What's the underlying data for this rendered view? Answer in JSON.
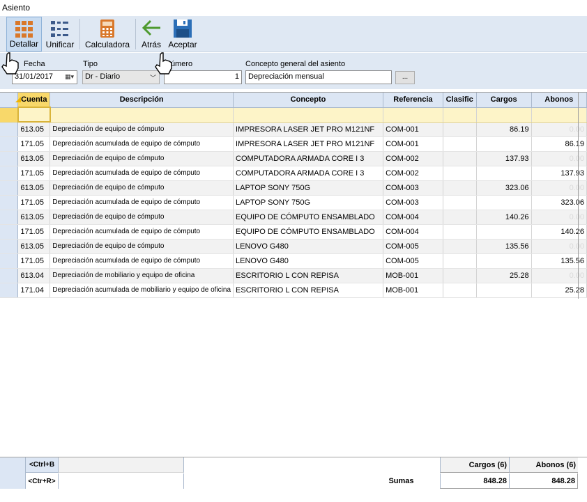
{
  "window": {
    "title": "Asiento"
  },
  "toolbar": {
    "buttons": [
      {
        "label": "Detallar",
        "icon": "grid-detail-icon"
      },
      {
        "label": "Unificar",
        "icon": "grid-unify-icon"
      },
      {
        "label": "Calculadora",
        "icon": "calculator-icon"
      },
      {
        "label": "Atrás",
        "icon": "back-arrow-icon"
      },
      {
        "label": "Aceptar",
        "icon": "save-disk-icon"
      }
    ]
  },
  "header": {
    "fecha_label": "Fecha",
    "fecha_value": "31/01/2017",
    "tipo_label": "Tipo",
    "tipo_value": "Dr - Diario",
    "numero_label": "Número",
    "numero_value": "1",
    "concepto_label": "Concepto general del asiento",
    "concepto_value": "Depreciación mensual",
    "ellipsis": "..."
  },
  "grid": {
    "columns": [
      "Cuenta",
      "Descripción",
      "Concepto",
      "Referencia",
      "Clasific",
      "Cargos",
      "Abonos"
    ],
    "rows": [
      {
        "cuenta": "613.05",
        "descripcion": "Depreciación de equipo de cómputo",
        "concepto": "IMPRESORA LASER JET PRO M121NF",
        "referencia": "COM-001",
        "cargos": "86.19",
        "abonos": "0.00"
      },
      {
        "cuenta": "171.05",
        "descripcion": "Depreciación acumulada de equipo de cómputo",
        "concepto": "IMPRESORA LASER JET PRO M121NF",
        "referencia": "COM-001",
        "cargos": "",
        "abonos": "86.19"
      },
      {
        "cuenta": "613.05",
        "descripcion": "Depreciación de equipo de cómputo",
        "concepto": "COMPUTADORA ARMADA CORE I 3",
        "referencia": "COM-002",
        "cargos": "137.93",
        "abonos": "0.00"
      },
      {
        "cuenta": "171.05",
        "descripcion": "Depreciación acumulada de equipo de cómputo",
        "concepto": "COMPUTADORA ARMADA CORE I 3",
        "referencia": "COM-002",
        "cargos": "",
        "abonos": "137.93"
      },
      {
        "cuenta": "613.05",
        "descripcion": "Depreciación de equipo de cómputo",
        "concepto": "LAPTOP SONY 750G",
        "referencia": "COM-003",
        "cargos": "323.06",
        "abonos": "0.00"
      },
      {
        "cuenta": "171.05",
        "descripcion": "Depreciación acumulada de equipo de cómputo",
        "concepto": "LAPTOP SONY 750G",
        "referencia": "COM-003",
        "cargos": "",
        "abonos": "323.06"
      },
      {
        "cuenta": "613.05",
        "descripcion": "Depreciación de equipo de cómputo",
        "concepto": "EQUIPO DE CÓMPUTO ENSAMBLADO",
        "referencia": "COM-004",
        "cargos": "140.26",
        "abonos": "0.00"
      },
      {
        "cuenta": "171.05",
        "descripcion": "Depreciación acumulada de equipo de cómputo",
        "concepto": "EQUIPO DE CÓMPUTO ENSAMBLADO",
        "referencia": "COM-004",
        "cargos": "",
        "abonos": "140.26"
      },
      {
        "cuenta": "613.05",
        "descripcion": "Depreciación de equipo de cómputo",
        "concepto": "LENOVO G480",
        "referencia": "COM-005",
        "cargos": "135.56",
        "abonos": "0.00"
      },
      {
        "cuenta": "171.05",
        "descripcion": "Depreciación acumulada de equipo de cómputo",
        "concepto": "LENOVO G480",
        "referencia": "COM-005",
        "cargos": "",
        "abonos": "135.56"
      },
      {
        "cuenta": "613.04",
        "descripcion": "Depreciación de mobiliario y equipo de oficina",
        "concepto": "ESCRITORIO L CON REPISA",
        "referencia": "MOB-001",
        "cargos": "25.28",
        "abonos": "0.00"
      },
      {
        "cuenta": "171.04",
        "descripcion": "Depreciación acumulada de mobiliario y equipo de oficina",
        "concepto": "ESCRITORIO L CON REPISA",
        "referencia": "MOB-001",
        "cargos": "",
        "abonos": "25.28"
      }
    ]
  },
  "footer": {
    "shortcut_b": "<Ctrl+B",
    "shortcut_r": "<Ctr+R>",
    "sumas_label": "Sumas",
    "cargos_label": "Cargos (6)",
    "abonos_label": "Abonos (6)",
    "cargos_total": "848.28",
    "abonos_total": "848.28"
  },
  "colors": {
    "toolbar_bg": "#dfe8f3",
    "header_yellow": "#f8d86a",
    "grid_header": "#dce6f4"
  }
}
